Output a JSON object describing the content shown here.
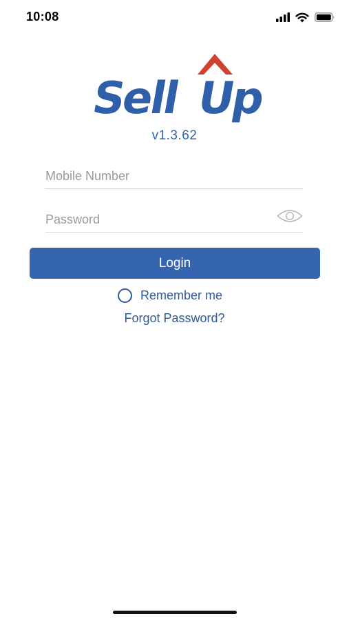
{
  "status_bar": {
    "time": "10:08",
    "icons": [
      "cellular-signal-icon",
      "wifi-icon",
      "battery-icon"
    ]
  },
  "brand": {
    "logo_text": "Sell Up",
    "version": "v1.3.62",
    "colors": {
      "primary": "#3565ae",
      "accent": "#d2402f",
      "link": "#2f5a9c"
    }
  },
  "login_form": {
    "mobile_field": {
      "placeholder": "Mobile Number",
      "value": ""
    },
    "password_field": {
      "placeholder": "Password",
      "value": ""
    },
    "show_password_icon": "eye-icon",
    "login_button": "Login",
    "remember_me": {
      "label": "Remember me",
      "checked": false
    },
    "forgot_password": "Forgot Password?"
  }
}
